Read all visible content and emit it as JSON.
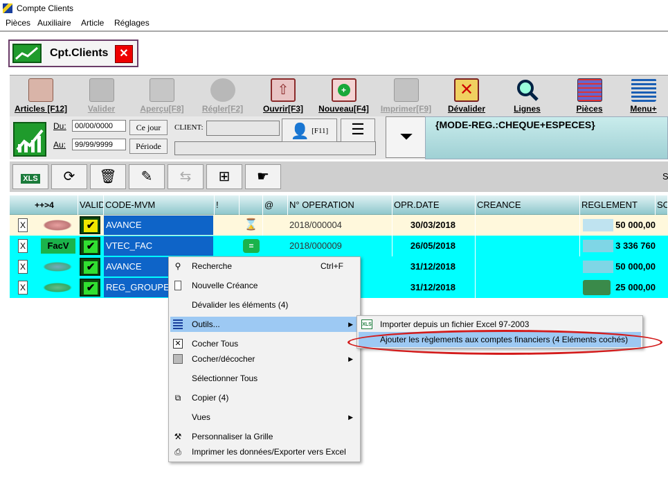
{
  "window": {
    "title": "Compte Clients"
  },
  "menu": [
    "Pièces",
    "Auxiliaire",
    "Article",
    "Réglages"
  ],
  "tab": {
    "label": "Cpt.Clients",
    "close": "✕"
  },
  "toolbar": [
    {
      "label": "Articles [F12]",
      "icon": "articles-icon",
      "disabled": false
    },
    {
      "label": "Valider",
      "icon": "validate-icon",
      "disabled": true
    },
    {
      "label": "Aperçu[F8]",
      "icon": "preview-icon",
      "disabled": true
    },
    {
      "label": "Régler[F2]",
      "icon": "pay-icon",
      "disabled": true
    },
    {
      "label": "Ouvrir[F3]",
      "icon": "open-icon",
      "disabled": false
    },
    {
      "label": "Nouveau[F4]",
      "icon": "new-icon",
      "disabled": false
    },
    {
      "label": "Imprimer[F9]",
      "icon": "print-icon",
      "disabled": true
    },
    {
      "label": "Dévalider",
      "icon": "unvalidate-icon",
      "disabled": false
    },
    {
      "label": "Lignes",
      "icon": "lines-icon",
      "disabled": false
    },
    {
      "label": "Pièces",
      "icon": "documents-icon",
      "disabled": false
    },
    {
      "label": "Menu+",
      "icon": "menu-icon",
      "disabled": false
    }
  ],
  "filter": {
    "du_label": "Du:",
    "du_value": "00/00/0000",
    "au_label": "Au:",
    "au_value": "99/99/9999",
    "ce_jour": "Ce jour",
    "periode": "Période",
    "client_label": "CLIENT:",
    "f11": "[F11]",
    "mode": "{MODE-REG.:CHEQUE+ESPECES}"
  },
  "toolbar2_right": "S",
  "grid": {
    "headers": [
      "++>4",
      "VALID",
      "CODE-MVM",
      "!",
      "",
      "@",
      "N° OPERATION",
      "OPR.DATE",
      "CREANCE",
      "REGLEMENT",
      "SO"
    ],
    "rows": [
      {
        "check": "X",
        "badge": "",
        "code": "AVANCE",
        "flag": "⌛",
        "op": "2018/000004",
        "date": "30/03/2018",
        "creance": "",
        "reglement": "50 000,00"
      },
      {
        "check": "X",
        "badge": "FacV",
        "code": "VTEC_FAC",
        "flag": "=",
        "op": "2018/000009",
        "date": "26/05/2018",
        "creance": "",
        "reglement": "3 336 760"
      },
      {
        "check": "X",
        "badge": "",
        "code": "AVANCE",
        "flag": "",
        "op": "",
        "date": "31/12/2018",
        "creance": "",
        "reglement": "50 000,00"
      },
      {
        "check": "X",
        "badge": "",
        "code": "REG_GROUPE",
        "flag": "",
        "op": "",
        "date": "31/12/2018",
        "creance": "",
        "reglement": "25 000,00"
      }
    ]
  },
  "context_menu": [
    {
      "label": "Recherche",
      "shortcut": "Ctrl+F",
      "icon": "binoculars-icon"
    },
    {
      "label": "Nouvelle Créance",
      "shortcut": "",
      "icon": "document-icon"
    },
    {
      "label": "Dévalider les éléments (4)",
      "shortcut": "",
      "icon": ""
    },
    {
      "label": "Outils...",
      "shortcut": "",
      "icon": "list-icon",
      "submenu": true
    },
    {
      "label": "Cocher Tous",
      "shortcut": "",
      "icon": "checkbox-x-icon"
    },
    {
      "label": "Cocher/décocher",
      "shortcut": "",
      "icon": "checkbox-gray-icon",
      "submenu": true
    },
    {
      "label": "Sélectionner Tous",
      "shortcut": "",
      "icon": ""
    },
    {
      "label": "Copier (4)",
      "shortcut": "",
      "icon": "copy-icon"
    },
    {
      "label": "Vues",
      "shortcut": "",
      "icon": "",
      "submenu": true
    },
    {
      "label": "Personnaliser la Grille",
      "shortcut": "",
      "icon": "tools-icon"
    },
    {
      "label": "Imprimer les données/Exporter vers Excel",
      "shortcut": "",
      "icon": "printer-icon"
    }
  ],
  "submenu": [
    {
      "label": "Importer depuis un fichier Excel 97-2003",
      "icon": "xls-icon"
    },
    {
      "label": "Ajouter les règlements aux comptes financiers (4 Eléments cochés)",
      "icon": ""
    }
  ],
  "colors": {
    "accent_blue": "#0e64c8",
    "row_cyan": "#00ffff",
    "row_cream": "#fff8dc",
    "highlight": "#9dc9f3",
    "annotation_red": "#d31b1b"
  }
}
